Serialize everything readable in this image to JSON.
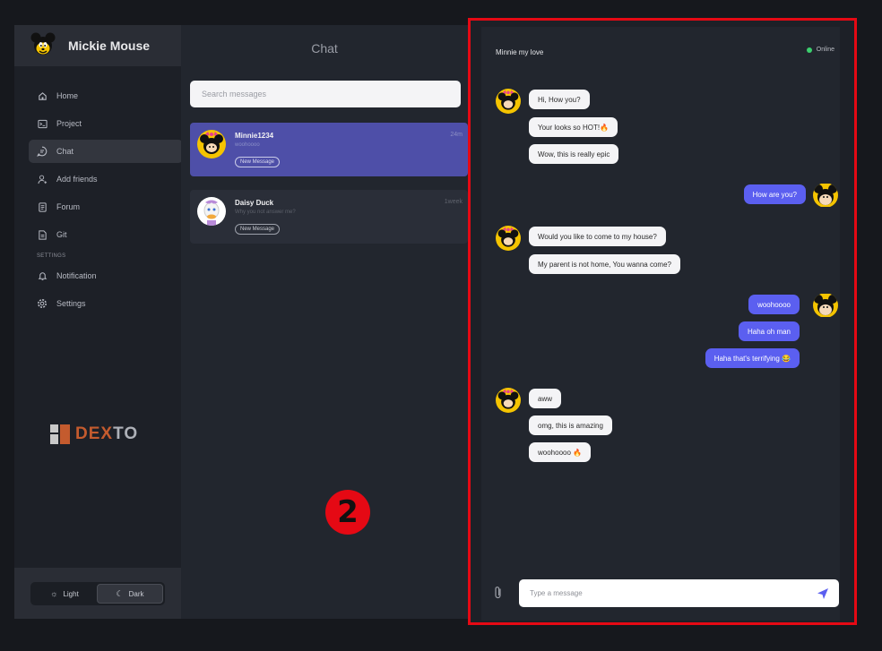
{
  "user": {
    "name": "Mickie Mouse",
    "avatar_icon": "mickey-avatar-icon"
  },
  "nav": {
    "items": [
      {
        "label": "Home",
        "icon": "home-icon"
      },
      {
        "label": "Project",
        "icon": "terminal-icon"
      },
      {
        "label": "Chat",
        "icon": "chat-bubble-icon",
        "active": true
      },
      {
        "label": "Add friends",
        "icon": "add-user-icon"
      },
      {
        "label": "Forum",
        "icon": "document-icon"
      },
      {
        "label": "Git",
        "icon": "file-text-icon"
      }
    ],
    "section_label": "SETTINGS",
    "settings_items": [
      {
        "label": "Notification",
        "icon": "bell-icon"
      },
      {
        "label": "Settings",
        "icon": "gear-icon"
      }
    ]
  },
  "brand": {
    "word_a": "DEX",
    "word_b": "TO"
  },
  "theme": {
    "light_label": "Light",
    "dark_label": "Dark",
    "selected": "Dark"
  },
  "chatlist": {
    "title": "Chat",
    "search_placeholder": "Search messages",
    "conversations": [
      {
        "name": "Minnie1234",
        "preview": "woohoooo",
        "time": "24m",
        "tag": "New Message",
        "avatar_icon": "minnie-avatar-icon"
      },
      {
        "name": "Daisy Duck",
        "preview": "Why you not answer me?",
        "time": "1week",
        "tag": "New Message",
        "avatar_icon": "daisy-avatar-icon"
      }
    ]
  },
  "panel": {
    "contact_name": "Minnie my love",
    "status": "Online",
    "status_color": "#3ccf6e",
    "messages": [
      {
        "from": "them",
        "text": "Hi, How you?"
      },
      {
        "from": "them",
        "text": "Your looks so HOT!🔥"
      },
      {
        "from": "them",
        "text": "Wow, this is really epic"
      },
      {
        "from": "me",
        "text": "How are you?"
      },
      {
        "from": "them",
        "text": "Would you like to come to my house?"
      },
      {
        "from": "them",
        "text": "My parent is not home, You wanna come?"
      },
      {
        "from": "me",
        "text": "woohoooo"
      },
      {
        "from": "me",
        "text": "Haha oh man"
      },
      {
        "from": "me",
        "text": "Haha that's terrifying 😂"
      },
      {
        "from": "them",
        "text": "aww"
      },
      {
        "from": "them",
        "text": "omg, this is amazing"
      },
      {
        "from": "them",
        "text": "woohoooo 🔥"
      }
    ],
    "input_placeholder": "Type a message",
    "accent_color": "#5b5ff0",
    "annotation_badge": "2"
  }
}
